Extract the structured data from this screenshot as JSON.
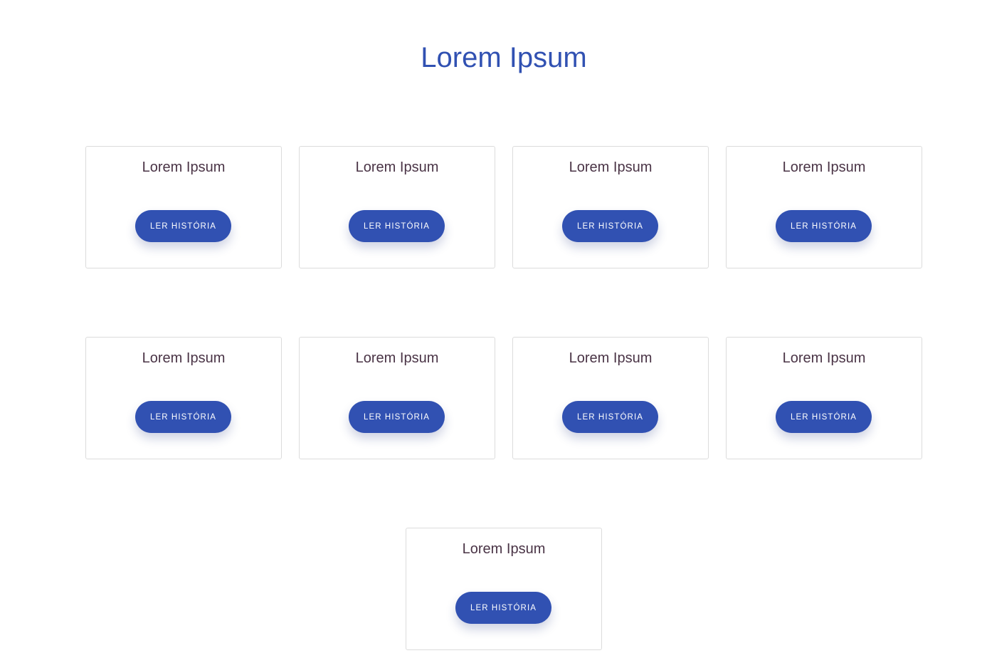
{
  "header": {
    "title": "Lorem Ipsum"
  },
  "colors": {
    "accent": "#3151b2",
    "card_title": "#4a3446",
    "card_border": "#dcdcdc"
  },
  "cards": [
    {
      "title": "Lorem Ipsum",
      "button_label": "LER HISTÓRIA"
    },
    {
      "title": "Lorem Ipsum",
      "button_label": "LER HISTÓRIA"
    },
    {
      "title": "Lorem Ipsum",
      "button_label": "LER HISTÓRIA"
    },
    {
      "title": "Lorem Ipsum",
      "button_label": "LER HISTÓRIA"
    },
    {
      "title": "Lorem Ipsum",
      "button_label": "LER HISTÓRIA"
    },
    {
      "title": "Lorem Ipsum",
      "button_label": "LER HISTÓRIA"
    },
    {
      "title": "Lorem Ipsum",
      "button_label": "LER HISTÓRIA"
    },
    {
      "title": "Lorem Ipsum",
      "button_label": "LER HISTÓRIA"
    },
    {
      "title": "Lorem Ipsum",
      "button_label": "LER HISTÓRIA"
    }
  ]
}
